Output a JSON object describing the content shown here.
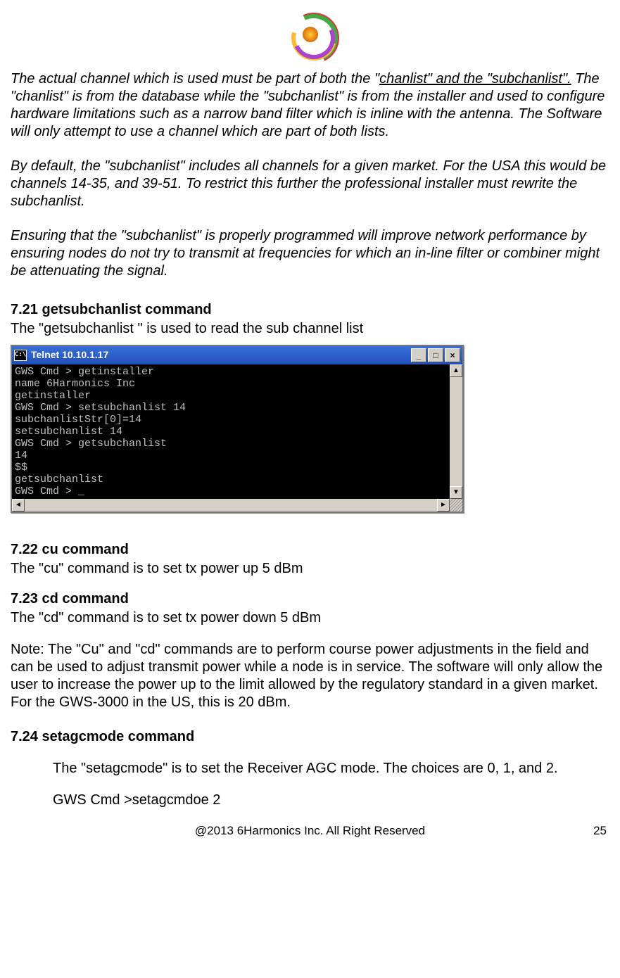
{
  "para1_pre": "The actual channel which is used must be part of both  the \"",
  "para1_u1": "chanlist\"  and the \"subchanlist\".",
  "para1_post": "    The \"chanlist\" is from the database while the \"subchanlist\" is from the installer and used to configure hardware limitations such as a narrow band filter which is inline with the antenna.   The Software will only attempt to use a channel which are part of both lists.",
  "para2": "By default, the \"subchanlist\" includes all channels for a given market.   For the USA this would be channels 14-35, and 39-51.   To restrict this further the professional installer must rewrite the subchanlist.",
  "para3": "Ensuring that the \"subchanlist\"  is properly programmed  will improve network performance by ensuring nodes do not try to transmit at frequencies for which an in-line filter or combiner might be attenuating the signal.",
  "sections": {
    "s721_h": "7.21  getsubchanlist  command",
    "s721_b": "The \"getsubchanlist \" is used to read the  sub channel list",
    "s722_h": " 7.22  cu  command",
    "s722_b": "The \"cu\" command is to set tx power up 5 dBm",
    "s723_h": "7.23   cd  command",
    "s723_b": "The \"cd\" command is to set tx power down 5 dBm",
    "s723_note": "Note:  The \"Cu\" and \"cd\" commands are to perform course power adjustments in the field and can be used to adjust transmit power while a node is in service.   The software will only allow the user to increase the power up to the limit allowed by the regulatory standard in a given market.   For the GWS-3000 in the US,  this is 20 dBm.",
    "s724_h": "7.24   setagcmode  command",
    "s724_b": "The \"setagcmode\"  is to set the Receiver AGC mode.  The choices are 0, 1, and 2.",
    "s724_cmd": "GWS Cmd >setagcmdoe 2"
  },
  "terminal": {
    "title": "Telnet 10.10.1.17",
    "icon_label": "C:\\",
    "lines": "GWS Cmd > getinstaller\nname 6Harmonics Inc\ngetinstaller\nGWS Cmd > setsubchanlist 14\nsubchanlistStr[0]=14\nsetsubchanlist 14\nGWS Cmd > getsubchanlist\n14\n$$\ngetsubchanlist\nGWS Cmd > _"
  },
  "footer": {
    "copyright": "@2013 6Harmonics Inc. All Right Reserved",
    "page": "25"
  }
}
